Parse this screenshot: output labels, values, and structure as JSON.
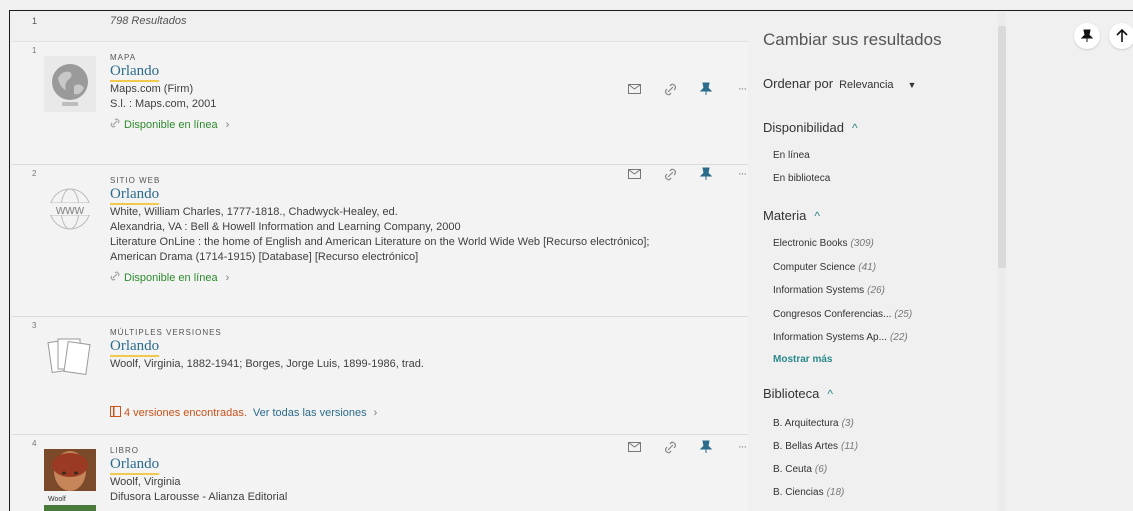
{
  "results_header": {
    "page_num": "1",
    "count": "798 Resultados"
  },
  "items": [
    {
      "idx": "1",
      "type": "MAPA",
      "title": "Orlando",
      "lines": [
        "Maps.com (Firm)",
        "S.l. : Maps.com, 2001"
      ],
      "availability": "Disponible en línea"
    },
    {
      "idx": "2",
      "type": "SITIO WEB",
      "title": "Orlando",
      "lines": [
        "White, William Charles, 1777-1818., Chadwyck-Healey, ed.",
        "Alexandria, VA : Bell & Howell Information and Learning Company, 2000",
        "Literature OnLine : the home of English and American Literature on the World Wide Web [Recurso electrónico];",
        "American Drama (1714-1915) [Database] [Recurso electrónico]"
      ],
      "availability": "Disponible en línea",
      "thumb_text": "www"
    },
    {
      "idx": "3",
      "type": "MÚLTIPLES VERSIONES",
      "title": "Orlando",
      "lines": [
        "Woolf, Virginia, 1882-1941; Borges, Jorge Luis, 1899-1986, trad."
      ],
      "versions_text": "4 versiones encontradas.",
      "versions_link": "Ver todas las versiones"
    },
    {
      "idx": "4",
      "type": "LIBRO",
      "title": "Orlando",
      "lines": [
        "Woolf, Virginia",
        "Difusora Larousse - Alianza Editorial"
      ],
      "thumb_text": "Woolf"
    }
  ],
  "sidebar": {
    "title": "Cambiar sus resultados",
    "sort_label": "Ordenar por",
    "sort_value": "Relevancia",
    "facets": [
      {
        "name": "Disponibilidad",
        "items": [
          {
            "label": "En línea",
            "count": ""
          },
          {
            "label": "En biblioteca",
            "count": ""
          }
        ]
      },
      {
        "name": "Materia",
        "items": [
          {
            "label": "Electronic Books",
            "count": "(309)"
          },
          {
            "label": "Computer Science",
            "count": "(41)"
          },
          {
            "label": "Information Systems",
            "count": "(26)"
          },
          {
            "label": "Congresos Conferencias...",
            "count": "(25)"
          },
          {
            "label": "Information Systems Ap...",
            "count": "(22)"
          }
        ],
        "more": "Mostrar más"
      },
      {
        "name": "Biblioteca",
        "items": [
          {
            "label": "B. Arquitectura",
            "count": "(3)"
          },
          {
            "label": "B. Bellas Artes",
            "count": "(11)"
          },
          {
            "label": "B. Ceuta",
            "count": "(6)"
          },
          {
            "label": "B. Ciencias",
            "count": "(18)"
          }
        ]
      }
    ]
  },
  "colors": {
    "link": "#2b6c8a",
    "available": "#2e8b2e",
    "versions": "#c9531a",
    "accent": "#2b8a8a",
    "highlight": "#f2c94c"
  },
  "icons": [
    "email-icon",
    "link-icon",
    "pin-icon",
    "more-icon",
    "arrow-up-icon"
  ]
}
